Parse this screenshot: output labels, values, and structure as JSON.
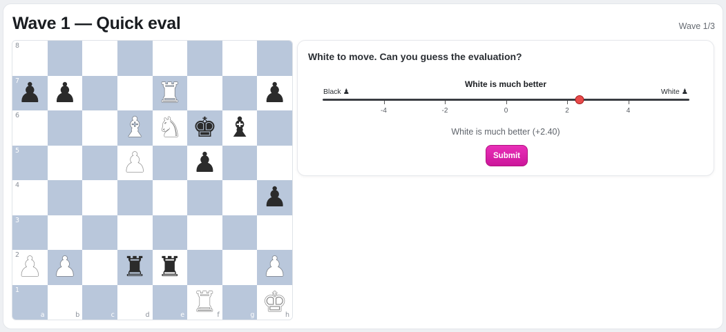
{
  "header": {
    "title": "Wave 1 — Quick eval",
    "wave_badge": "Wave 1/3"
  },
  "board": {
    "files": [
      "a",
      "b",
      "c",
      "d",
      "e",
      "f",
      "g",
      "h"
    ],
    "ranks": [
      "8",
      "7",
      "6",
      "5",
      "4",
      "3",
      "2",
      "1"
    ],
    "pieces": [
      {
        "square": "a7",
        "color": "b",
        "type": "p"
      },
      {
        "square": "b7",
        "color": "b",
        "type": "p"
      },
      {
        "square": "e7",
        "color": "w",
        "type": "r"
      },
      {
        "square": "h7",
        "color": "b",
        "type": "p"
      },
      {
        "square": "d6",
        "color": "w",
        "type": "b"
      },
      {
        "square": "e6",
        "color": "w",
        "type": "n"
      },
      {
        "square": "f6",
        "color": "b",
        "type": "k"
      },
      {
        "square": "g6",
        "color": "b",
        "type": "b"
      },
      {
        "square": "d5",
        "color": "w",
        "type": "p"
      },
      {
        "square": "f5",
        "color": "b",
        "type": "p"
      },
      {
        "square": "h4",
        "color": "b",
        "type": "p"
      },
      {
        "square": "a2",
        "color": "w",
        "type": "p"
      },
      {
        "square": "b2",
        "color": "w",
        "type": "p"
      },
      {
        "square": "d2",
        "color": "b",
        "type": "r"
      },
      {
        "square": "e2",
        "color": "b",
        "type": "r"
      },
      {
        "square": "h2",
        "color": "w",
        "type": "p"
      },
      {
        "square": "f1",
        "color": "w",
        "type": "r"
      },
      {
        "square": "h1",
        "color": "w",
        "type": "k"
      }
    ],
    "colors": {
      "light": "#ffffff",
      "dark": "#b9c7db"
    }
  },
  "panel": {
    "prompt": "White to move. Can you guess the evaluation?",
    "slider_title": "White is much better",
    "left_label": "Black ♟",
    "right_label": "White ♟",
    "min": -6,
    "max": 6,
    "ticks": [
      "-4",
      "-2",
      "0",
      "2",
      "4"
    ],
    "value": 2.4,
    "readout": "White is much better (+2.40)",
    "submit_label": "Submit"
  },
  "colors": {
    "accent": "#d61fa6",
    "thumb": "#e84a4a"
  }
}
